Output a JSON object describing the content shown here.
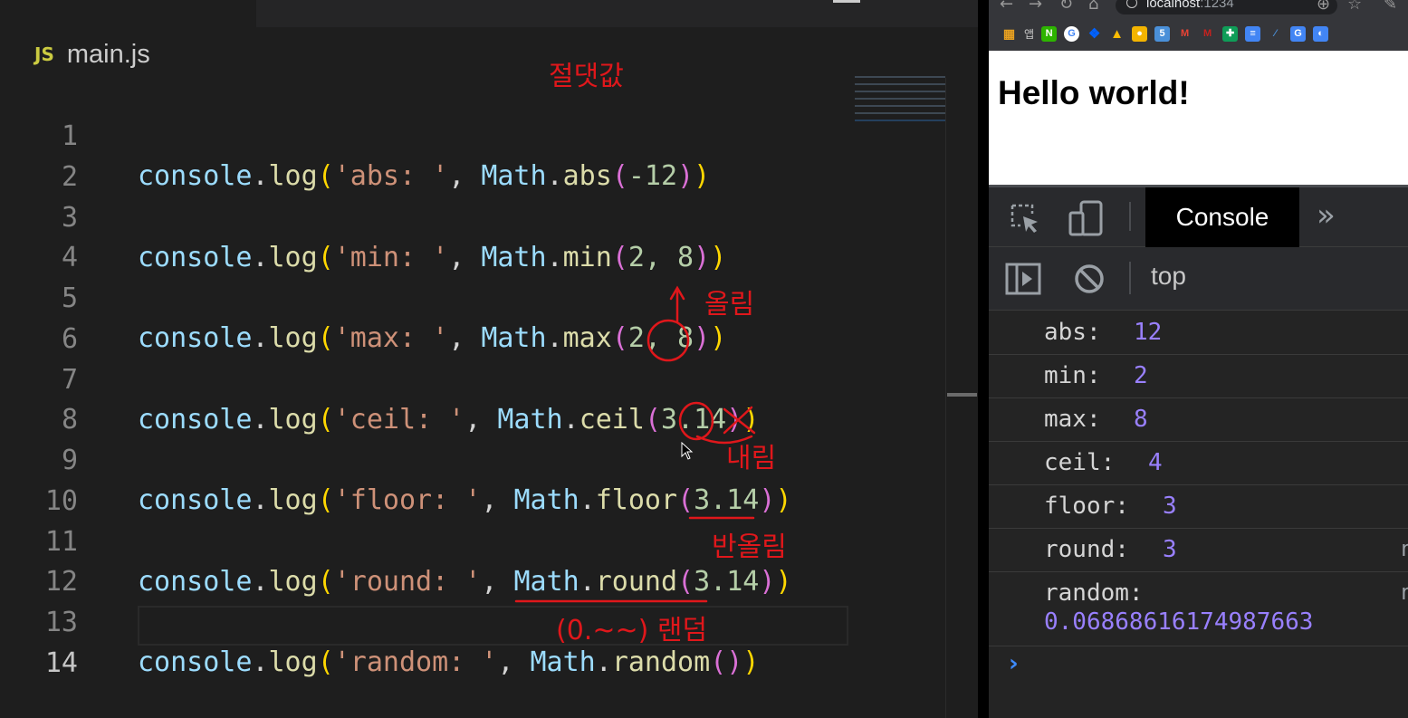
{
  "editor": {
    "file_icon": "JS",
    "file_name": "main.js",
    "lines": [
      {
        "num": "1",
        "str": "'abs: '",
        "method": "abs",
        "args": "-12"
      },
      {
        "num": "2"
      },
      {
        "num": "3",
        "str": "'min: '",
        "method": "min",
        "args": "2, 8"
      },
      {
        "num": "4"
      },
      {
        "num": "5",
        "str": "'max: '",
        "method": "max",
        "args": "2, 8"
      },
      {
        "num": "6"
      },
      {
        "num": "7",
        "str": "'ceil: '",
        "method": "ceil",
        "args": "3.14"
      },
      {
        "num": "8"
      },
      {
        "num": "9",
        "str": "'floor: '",
        "method": "floor",
        "args": "3.14"
      },
      {
        "num": "10"
      },
      {
        "num": "11",
        "str": "'round: '",
        "method": "round",
        "args": "3.14"
      },
      {
        "num": "12"
      },
      {
        "num": "13",
        "str": "'random: '",
        "method": "random",
        "args": ""
      },
      {
        "num": "14"
      }
    ],
    "tokens": {
      "console": "console",
      "log": "log",
      "math": "Math"
    }
  },
  "annotations": {
    "abs_note": "절댓값",
    "ceil_note": "올림",
    "floor_note": "내림",
    "round_note": "반올림",
    "random_note": "(0.~~) 랜덤"
  },
  "browser": {
    "url_host": "localhost",
    "url_port": ":1234",
    "bookmarks_label": "앱",
    "page_heading": "Hello world!"
  },
  "devtools": {
    "active_tab": "Console",
    "more_tabs": "»",
    "context": "top",
    "console_rows": [
      {
        "label": "abs: ",
        "value": "12"
      },
      {
        "label": "min: ",
        "value": "2"
      },
      {
        "label": "max: ",
        "value": "8"
      },
      {
        "label": "ceil: ",
        "value": "4"
      },
      {
        "label": "floor: ",
        "value": "3"
      },
      {
        "label": "round: ",
        "value": "3"
      },
      {
        "label": "random:",
        "value": "0.06868616174987663"
      }
    ],
    "prompt": "›"
  },
  "colors": {
    "annotation_red": "#e0171b",
    "console_value": "#9980ff"
  }
}
